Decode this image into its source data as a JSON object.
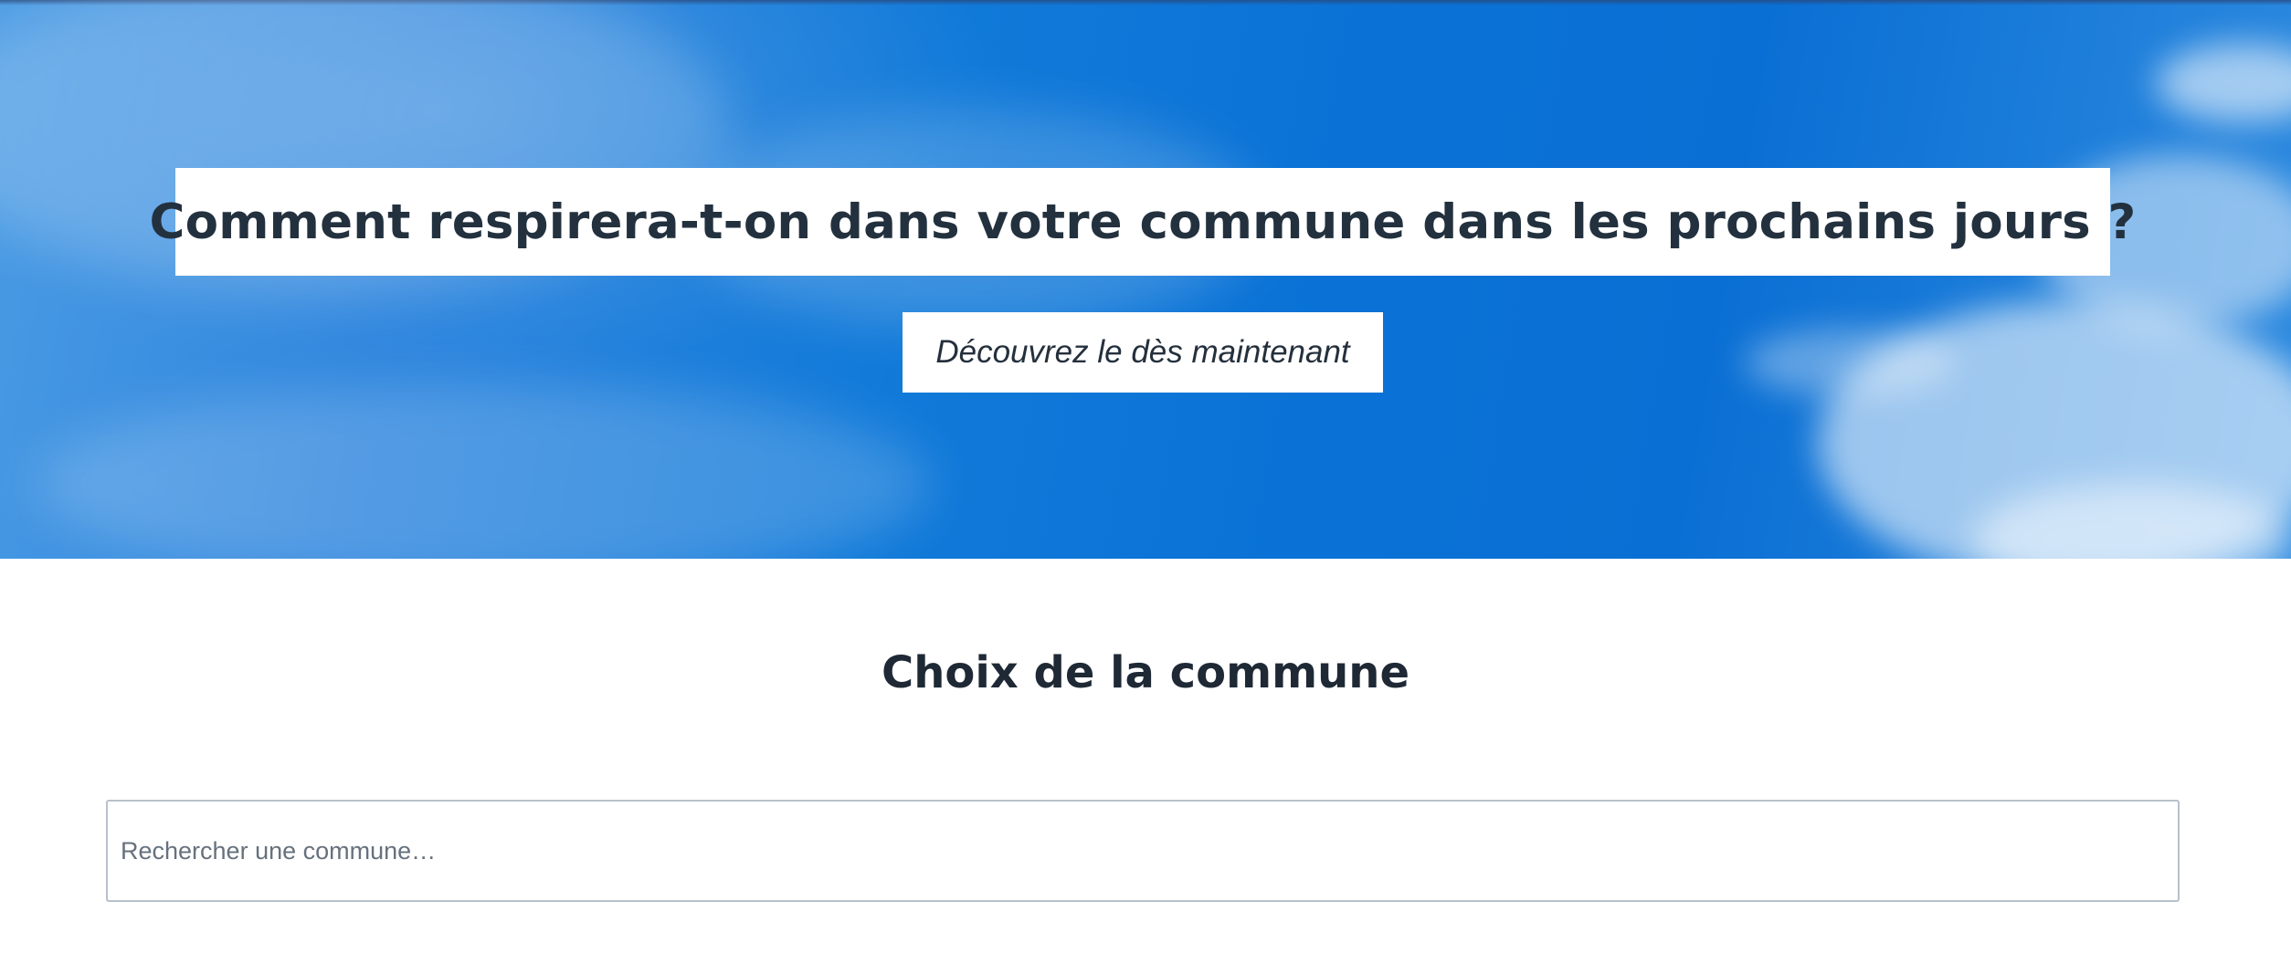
{
  "hero": {
    "headline": "Comment respirera-t-on dans votre commune dans les prochains jours ?",
    "cta_label": "Découvrez le dès maintenant"
  },
  "commune_section": {
    "title": "Choix de la commune",
    "search": {
      "value": "",
      "placeholder": "Rechercher une commune…"
    }
  },
  "colors": {
    "sky_primary": "#0a72d6",
    "sky_light": "#4a9be4",
    "text_dark": "#23313f",
    "input_border": "#b7c1cc"
  }
}
